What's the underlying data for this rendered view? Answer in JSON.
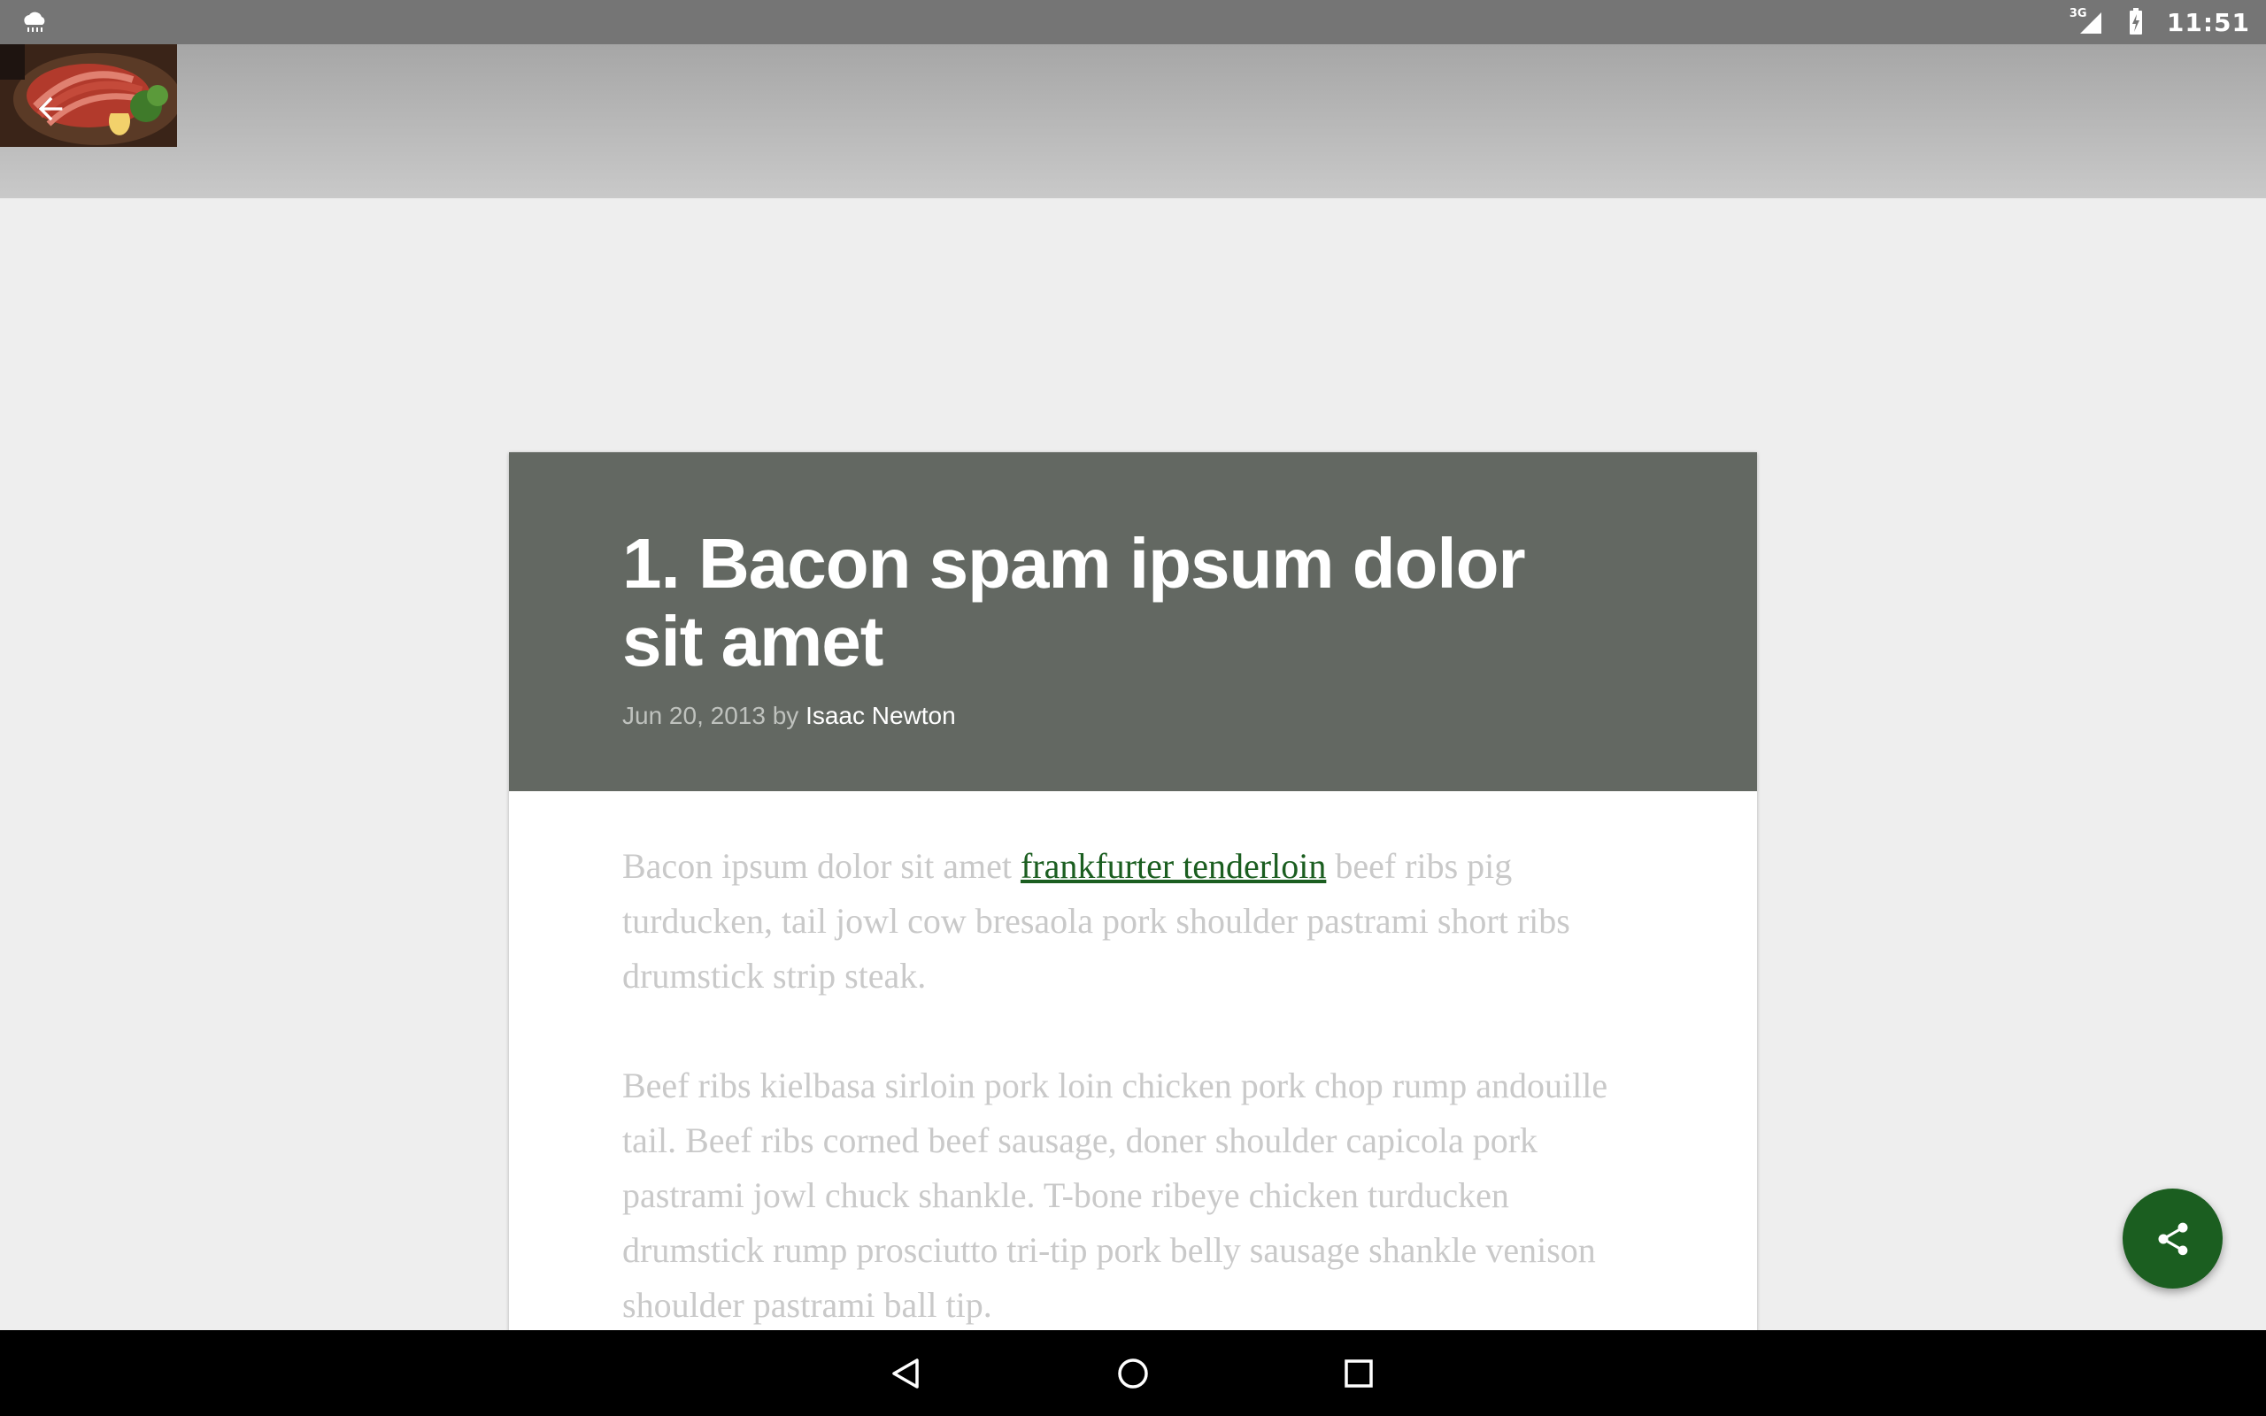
{
  "status_bar": {
    "time": "11:51",
    "network_label": "3G",
    "icons": [
      "weather-cloud-icon",
      "signal-icon",
      "battery-icon"
    ]
  },
  "app_bar": {
    "hero_image": "steak-dish-photo",
    "back_icon": "arrow-back-icon"
  },
  "article": {
    "title": "1. Bacon spam ipsum dolor sit amet",
    "date": "Jun 20, 2013",
    "by": "by",
    "author": "Isaac Newton",
    "paragraph1_before": "Bacon ipsum dolor sit amet ",
    "paragraph1_link": "frankfurter tenderloin",
    "paragraph1_after": " beef ribs pig turducken, tail jowl cow bresaola pork shoulder pastrami short ribs drumstick strip steak.",
    "paragraph2": "Beef ribs kielbasa sirloin pork loin chicken pork chop rump andouille tail. Beef ribs corned beef sausage, doner shoulder capicola pork pastrami jowl chuck shankle. T-bone ribeye chicken turducken drumstick rump prosciutto tri-tip pork belly sausage shankle venison shoulder pastrami ball tip."
  },
  "fab": {
    "icon": "share-icon"
  },
  "nav_bar": {
    "icons": [
      "nav-back-icon",
      "nav-home-icon",
      "nav-recents-icon"
    ]
  },
  "colors": {
    "header_bg": "#636862",
    "accent": "#1b5e20",
    "body_text": "#c9c9c9",
    "status_bar": "#757575"
  }
}
